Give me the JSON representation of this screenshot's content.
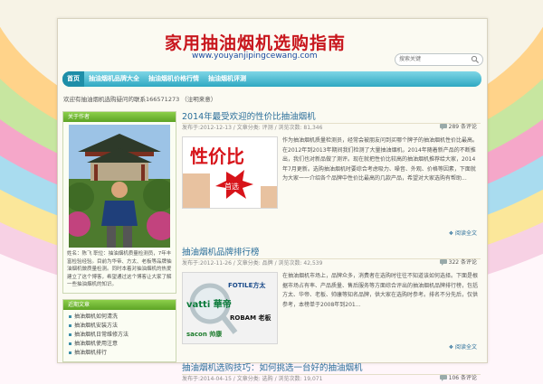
{
  "header": {
    "title": "家用抽油烟机选购指南",
    "url": "www.youyanjipingcewang.com"
  },
  "search": {
    "placeholder": "搜索关键"
  },
  "nav": {
    "items": [
      "首页",
      "抽油烟机品牌大全",
      "抽油烟机价格行情",
      "抽油烟机评测"
    ]
  },
  "notice": "欢迎有抽油烟机选购疑问的联系166571273 （注明来意）",
  "sidebar": {
    "about_title": "关于作者",
    "about_text": "姓名：陈飞  职位：抽油烟机质量检测员，7年丰富检验经验。目前为华帝、方太、老板等品牌抽油烟机做质量检测。同时本着对抽油烟机的热爱建立了这个博客，希望通过这个博客让大家了解一些抽油烟机的知识。",
    "links_title": "近期文章",
    "links": [
      "抽油烟机如何清洗",
      "抽油烟机安装方法",
      "抽油烟机日常维修方法",
      "抽油烟机使用注意",
      "抽油烟机排行"
    ]
  },
  "posts": [
    {
      "title": "2014年最受欢迎的性价比抽油烟机",
      "meta": "发布于:2012-12-13 / 文章分类: 评测 / 浏览次数: 81,346",
      "comments": "289 条评论",
      "thumb_text": "性价比",
      "thumb_tag": "首选",
      "excerpt": "作为抽油烟机质量检测员，经常会被朋友问到买哪个牌子的抽油烟机性价比最高。在2012年到2013年期间我们检测了大量抽油烟机，2014年随着新产品的不断推出，我们也对新品做了测评。现在就把性价比较高的抽油烟机推荐给大家，2014年7月更新。选购抽油烟机时要综合考虑吸力、噪音、外观、价格等因素，下面就为大家一一介绍各个品牌中性价比最高的几款产品，希望对大家选购有帮助...",
      "readmore": "阅读全文"
    },
    {
      "title": "抽油烟机品牌排行榜",
      "meta": "发布于:2012-11-26 / 文章分类: 品牌 / 浏览次数: 42,539",
      "comments": "322 条评论",
      "thumb_brands": [
        "FOTILE方太",
        "vatti 華帝",
        "ROBAM 老板",
        "sacon 帅康"
      ],
      "excerpt": "在抽油烟机市场上，品牌众多，消费者在选购时往往不知道该如何选择。下面是根据市场占有率、产品质量、售后服务等方面综合评出的抽油烟机品牌排行榜，包括方太、华帝、老板、帅康等知名品牌，供大家在选购时参考。排名不分先后，仅供参考，本榜单于2008年到201...",
      "readmore": "阅读全文"
    },
    {
      "title": "抽油烟机选购技巧：如何挑选一台好的抽油烟机",
      "meta": "发布于:2014-04-15 / 文章分类: 选购 / 浏览次数: 19,071",
      "comments": "106 条评论"
    }
  ]
}
